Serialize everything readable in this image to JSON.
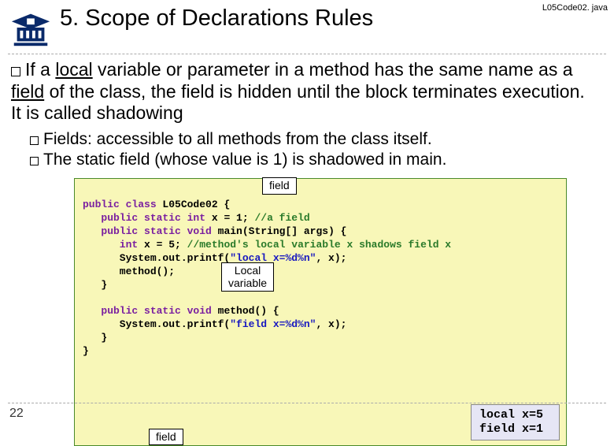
{
  "header": {
    "title": "5. Scope of Declarations Rules",
    "file_label": "L05Code02. java"
  },
  "bullet_main": {
    "prefix": "If a ",
    "u1": "local",
    "mid1": " variable or parameter in a method has the same name as a ",
    "u2": "field",
    "mid2": " of the class, the field is hidden until the block terminates execution. It is called shadowing"
  },
  "sub_bullets": {
    "b1": "Fields: accessible to all methods from the class itself.",
    "b2": "The static field (whose value is 1) is shadowed in main."
  },
  "code": {
    "l1a": "public",
    "l1b": " class",
    "l1c": " L05Code02 {",
    "l2a": "   public",
    "l2b": " static",
    "l2c": " int",
    "l2d": " x = 1; ",
    "l2e": "//a field",
    "l3a": "   public",
    "l3b": " static",
    "l3c": " void",
    "l3d": " main(String[] args) {",
    "l4a": "      int",
    "l4b": " x = 5; ",
    "l4c": "//method's local variable x shadows field x",
    "l5a": "      System.out.printf(",
    "l5b": "\"local x=%d%n\"",
    "l5c": ", x);",
    "l6": "      method();",
    "l7": "   }",
    "l8": "",
    "l9a": "   public",
    "l9b": " static",
    "l9c": " void",
    "l9d": " method() {",
    "l10a": "      System.out.printf(",
    "l10b": "\"field x=%d%n\"",
    "l10c": ", x);",
    "l11": "   }",
    "l12": "}"
  },
  "annotations": {
    "field1": "field",
    "local": "Local\nvariable",
    "field2": "field"
  },
  "output": "local x=5\nfield x=1",
  "page_number": "22"
}
